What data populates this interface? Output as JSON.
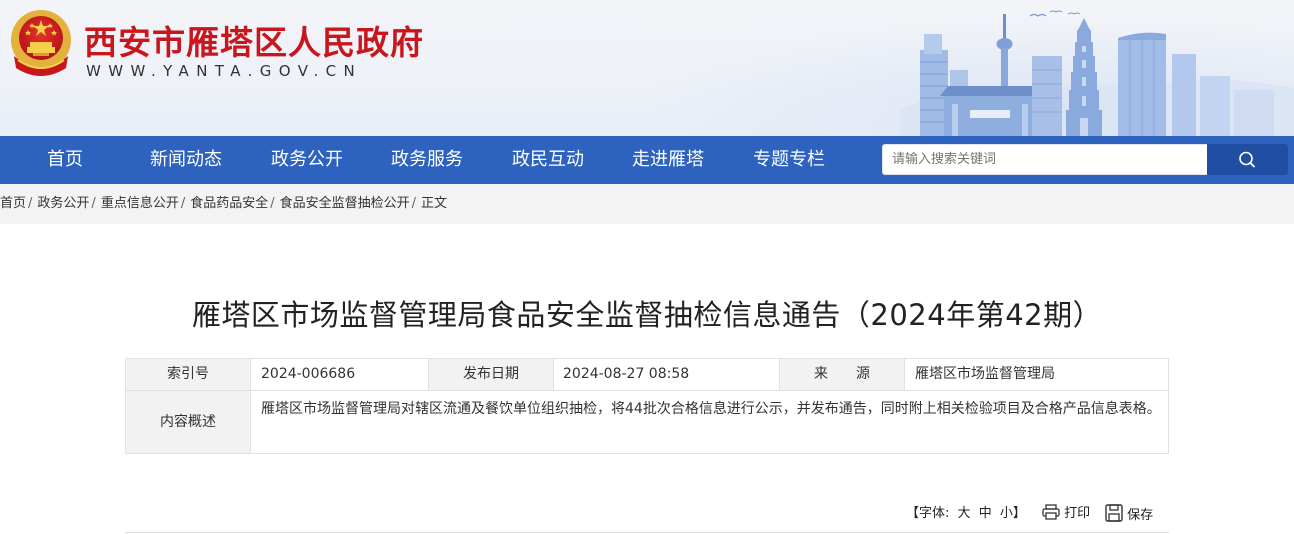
{
  "header": {
    "site_title": "西安市雁塔区人民政府",
    "site_url": "WWW.YANTA.GOV.CN"
  },
  "nav": {
    "items": [
      "首页",
      "新闻动态",
      "政务公开",
      "政务服务",
      "政民互动",
      "走进雁塔",
      "专题专栏"
    ]
  },
  "search": {
    "placeholder": "请输入搜索关键词",
    "icon": "search-icon"
  },
  "breadcrumb": {
    "items": [
      "首页",
      "政务公开",
      "重点信息公开",
      "食品药品安全",
      "食品安全监督抽检公开",
      "正文"
    ],
    "separator": "/"
  },
  "article": {
    "title": "雁塔区市场监督管理局食品安全监督抽检信息通告（2024年第42期）",
    "meta": {
      "index_label": "索引号",
      "index_value": "2024-006686",
      "date_label": "发布日期",
      "date_value": "2024-08-27 08:58",
      "source_label": "来　　源",
      "source_value": "雁塔区市场监督管理局",
      "summary_label": "内容概述",
      "summary_value": "雁塔区市场监督管理局对辖区流通及餐饮单位组织抽检，将44批次合格信息进行公示，并发布通告，同时附上相关检验项目及合格产品信息表格。"
    }
  },
  "tools": {
    "font_prefix": "【字体:",
    "font_large": "大",
    "font_medium": "中",
    "font_small": "小",
    "font_suffix": "】",
    "print": "打印",
    "save": "保存"
  },
  "colors": {
    "title_red": "#c8161d",
    "nav_blue": "#2d63be",
    "search_btn": "#1f4ea3"
  }
}
